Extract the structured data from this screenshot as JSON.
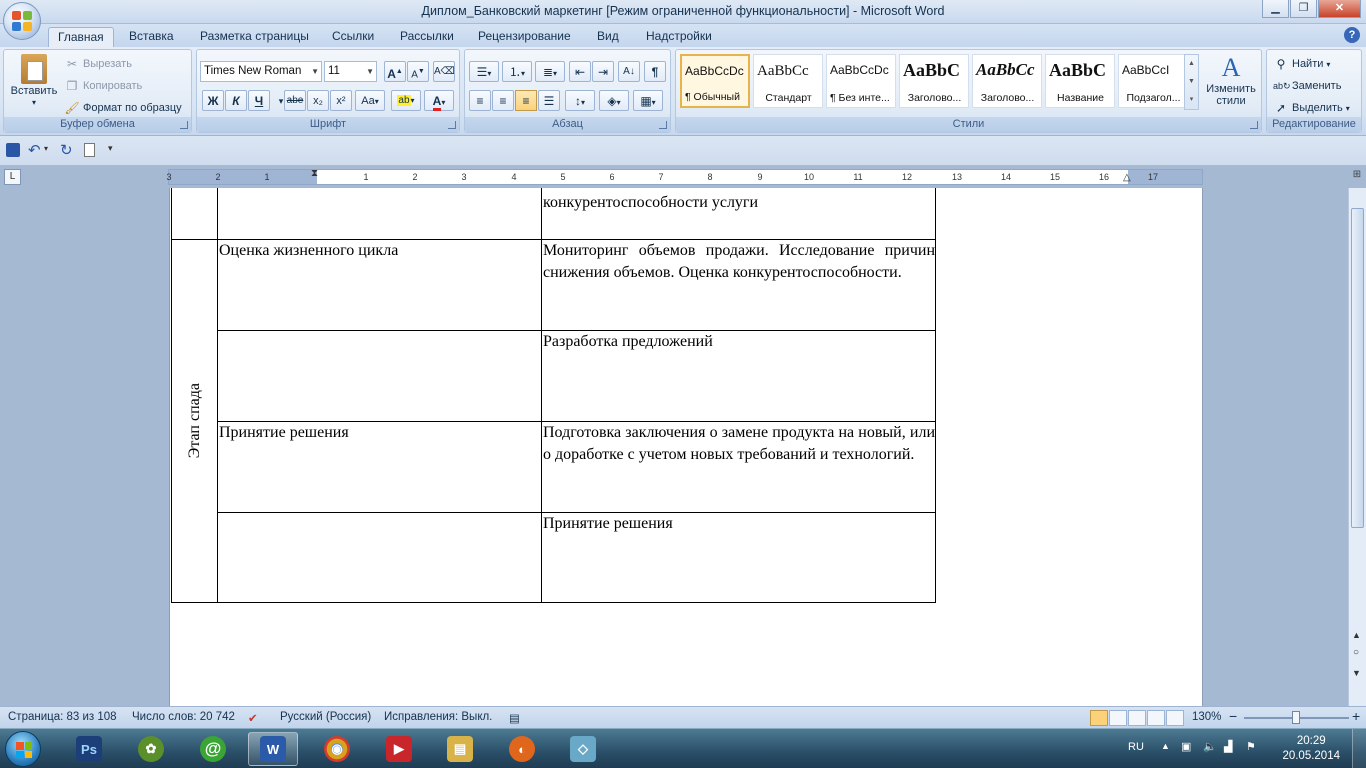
{
  "window": {
    "title": "Диплом_Банковский маркетинг [Режим ограниченной функциональности] - Microsoft Word",
    "min": "▁",
    "max": "❐",
    "close": "✕"
  },
  "tabs": [
    "Главная",
    "Вставка",
    "Разметка страницы",
    "Ссылки",
    "Рассылки",
    "Рецензирование",
    "Вид",
    "Надстройки"
  ],
  "ribbon": {
    "clipboard": {
      "label": "Буфер обмена",
      "paste": "Вставить",
      "cut": "Вырезать",
      "copy": "Копировать",
      "format_painter": "Формат по образцу"
    },
    "font": {
      "label": "Шрифт",
      "font_name": "Times New Roman",
      "font_size": "11",
      "bold": "Ж",
      "italic": "К",
      "underline": "Ч",
      "strike": "abe",
      "subscript": "x₂",
      "superscript": "x²",
      "case": "Aa",
      "grow": "A",
      "shrink": "A",
      "highlight": "ab",
      "color": "A"
    },
    "paragraph": {
      "label": "Абзац",
      "pilcrow": "¶"
    },
    "styles": {
      "label": "Стили",
      "items": [
        {
          "sample": "AaBbCcDc",
          "name": "¶ Обычный"
        },
        {
          "sample": "AaBbCc",
          "name": "Стандарт"
        },
        {
          "sample": "AaBbCcDc",
          "name": "¶ Без инте..."
        },
        {
          "sample": "AaBbC",
          "name": "Заголово..."
        },
        {
          "sample": "AaBbCc",
          "name": "Заголово..."
        },
        {
          "sample": "AaBbC",
          "name": "Название"
        },
        {
          "sample": "AaBbCcI",
          "name": "Подзагол..."
        }
      ],
      "change_styles": "Изменить стили"
    },
    "editing": {
      "label": "Редактирование",
      "find": "Найти",
      "replace": "Заменить",
      "select": "Выделить"
    }
  },
  "ruler": {
    "ticks": [
      "3",
      "2",
      "1",
      "",
      "1",
      "2",
      "3",
      "4",
      "5",
      "6",
      "7",
      "8",
      "9",
      "10",
      "11",
      "12",
      "13",
      "14",
      "15",
      "16",
      "",
      "17"
    ]
  },
  "document": {
    "table": {
      "top_partial": "конкурентоспособности услуги",
      "stage_label": "Этап спада",
      "rows": [
        {
          "col2": "Оценка жизненного цикла",
          "col3": "Мониторинг объемов продажи. Исследование причин снижения объемов. Оценка конкурентоспособности."
        },
        {
          "col2": "",
          "col3": "Разработка предложений"
        },
        {
          "col2": "Принятие решения",
          "col3": "Подготовка заключения о замене продукта на новый, или о доработке с учетом новых требований и технологий."
        },
        {
          "col2": "",
          "col3": "Принятие решения"
        }
      ]
    }
  },
  "statusbar": {
    "page": "Страница: 83 из 108",
    "words": "Число слов: 20 742",
    "language": "Русский (Россия)",
    "track": "Исправления: Выкл.",
    "zoom": "130%",
    "zoom_minus": "−",
    "zoom_plus": "+"
  },
  "taskbar": {
    "apps": [
      {
        "name": "photoshop",
        "glyph": "Ps",
        "color": "#1c3f7a"
      },
      {
        "name": "icq",
        "glyph": "✿",
        "color": "#5a8f2a"
      },
      {
        "name": "mail-agent",
        "glyph": "@",
        "color": "#3aa435"
      },
      {
        "name": "word",
        "glyph": "W",
        "color": "#2a5aa8"
      },
      {
        "name": "chrome",
        "glyph": "◉",
        "color": "#d8a21c"
      },
      {
        "name": "video",
        "glyph": "▶",
        "color": "#c8262b"
      },
      {
        "name": "explorer",
        "glyph": "▤",
        "color": "#d8b34a"
      },
      {
        "name": "firefox",
        "glyph": "◐",
        "color": "#e0661c"
      },
      {
        "name": "app",
        "glyph": "◇",
        "color": "#6aa8c8"
      }
    ],
    "language": "RU",
    "time": "20:29",
    "date": "20.05.2014"
  }
}
